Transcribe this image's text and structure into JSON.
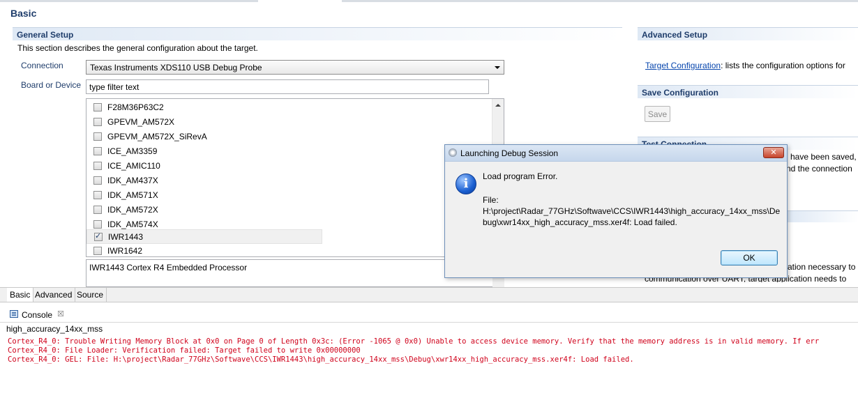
{
  "page": {
    "title": "Basic"
  },
  "general": {
    "heading": "General Setup",
    "description": "This section describes the general configuration about the target.",
    "connection_label": "Connection",
    "connection_value": "Texas Instruments XDS110 USB Debug Probe",
    "board_label": "Board or Device",
    "filter_placeholder": "type filter text",
    "devices": [
      {
        "name": "F28M36P63C2",
        "checked": false
      },
      {
        "name": "GPEVM_AM572X",
        "checked": false
      },
      {
        "name": "GPEVM_AM572X_SiRevA",
        "checked": false
      },
      {
        "name": "ICE_AM3359",
        "checked": false
      },
      {
        "name": "ICE_AMIC110",
        "checked": false
      },
      {
        "name": "IDK_AM437X",
        "checked": false
      },
      {
        "name": "IDK_AM571X",
        "checked": false
      },
      {
        "name": "IDK_AM572X",
        "checked": false
      },
      {
        "name": "IDK_AM574X",
        "checked": false
      },
      {
        "name": "IWR1443",
        "checked": true
      },
      {
        "name": "IWR1642",
        "checked": false
      }
    ],
    "device_description": "IWR1443 Cortex R4 Embedded Processor"
  },
  "advanced": {
    "heading": "Advanced Setup",
    "link": "Target Configuration",
    "text": ": lists the configuration options for"
  },
  "save": {
    "heading": "Save Configuration",
    "button": "Save"
  },
  "test": {
    "heading": "Test Connection",
    "line1": "have been saved,",
    "line2": "nd the connection"
  },
  "advanced_bg": {
    "line1": "ation necessary to",
    "line2": "communication over UART, target application needs to"
  },
  "tabs": [
    "Basic",
    "Advanced",
    "Source"
  ],
  "console": {
    "title": "Console",
    "close": "☒",
    "name": "high_accuracy_14xx_mss",
    "lines": [
      "Cortex_R4_0: Trouble Writing Memory Block at 0x0 on Page 0 of Length 0x3c: (Error -1065 @ 0x0) Unable to access device memory. Verify that the memory address is in valid memory. If err",
      "Cortex_R4_0: File Loader: Verification failed: Target failed to write 0x00000000",
      "Cortex_R4_0: GEL: File: H:\\project\\Radar_77GHz\\Softwave\\CCS\\IWR1443\\high_accuracy_14xx_mss\\Debug\\xwr14xx_high_accuracy_mss.xer4f: Load failed."
    ],
    "error_color": "#d0021b"
  },
  "dialog": {
    "title": "Launching Debug Session",
    "close": "✕",
    "message": "Load program Error.",
    "file_label": "File:",
    "file_path_1": "H:\\project\\Radar_77GHz\\Softwave\\CCS\\IWR1443\\high_accuracy_14xx_mss\\De",
    "file_path_2": "bug\\xwr14xx_high_accuracy_mss.xer4f: Load failed.",
    "ok": "OK",
    "icon": "info-icon"
  }
}
